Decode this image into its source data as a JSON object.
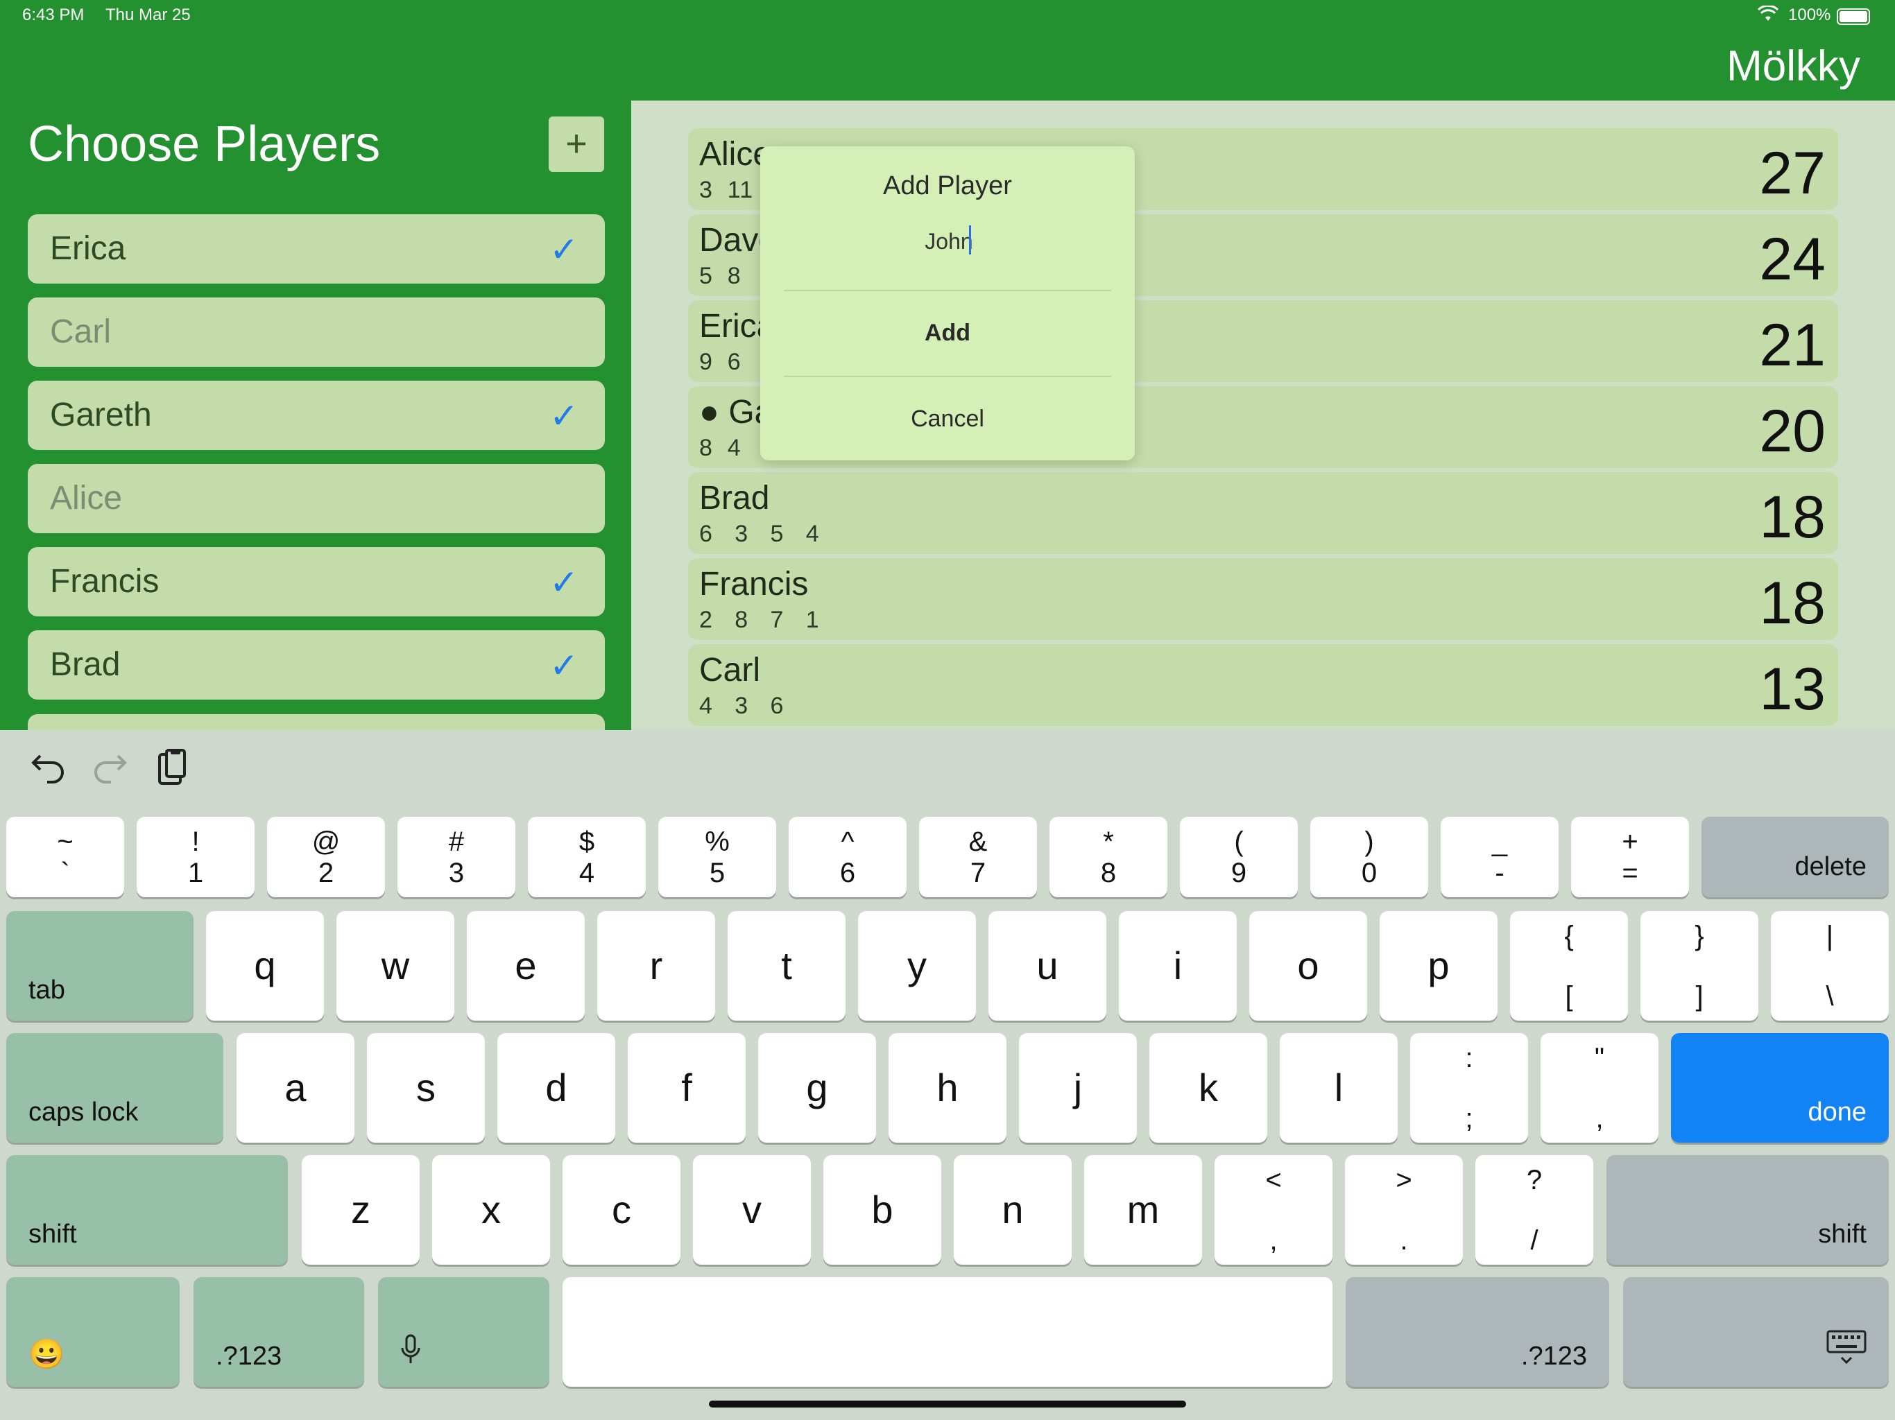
{
  "status_bar": {
    "time": "6:43 PM",
    "date": "Thu Mar 25",
    "battery": "100%"
  },
  "nav": {
    "app_title": "Mölkky"
  },
  "left_panel": {
    "title": "Choose Players",
    "add_button": "+",
    "players": [
      {
        "name": "Erica",
        "selected": true
      },
      {
        "name": "Carl",
        "selected": false
      },
      {
        "name": "Gareth",
        "selected": true
      },
      {
        "name": "Alice",
        "selected": false
      },
      {
        "name": "Francis",
        "selected": true
      },
      {
        "name": "Brad",
        "selected": true
      }
    ],
    "check_glyph": "✓"
  },
  "scoreboard": {
    "rows": [
      {
        "name": "Alice",
        "throws": "3  11",
        "score": "27"
      },
      {
        "name": "Dave",
        "throws": "5  8",
        "score": "24"
      },
      {
        "name": "Erica",
        "throws": "9  6",
        "score": "21"
      },
      {
        "name": "● Ga",
        "throws": "8  4",
        "score": "20"
      },
      {
        "name": "Brad",
        "throws": "6   3   5   4",
        "score": "18"
      },
      {
        "name": "Francis",
        "throws": "2   8   7   1",
        "score": "18"
      },
      {
        "name": "Carl",
        "throws": "4   3   6",
        "score": "13"
      }
    ]
  },
  "dialog": {
    "title": "Add Player",
    "input_value": "John",
    "add_label": "Add",
    "cancel_label": "Cancel"
  },
  "keyboard": {
    "toolbar": {
      "undo_icon": "undo-icon",
      "redo_icon": "redo-icon",
      "paste_icon": "clipboard-icon"
    },
    "row1": [
      {
        "top": "~",
        "bot": "`"
      },
      {
        "top": "!",
        "bot": "1"
      },
      {
        "top": "@",
        "bot": "2"
      },
      {
        "top": "#",
        "bot": "3"
      },
      {
        "top": "$",
        "bot": "4"
      },
      {
        "top": "%",
        "bot": "5"
      },
      {
        "top": "^",
        "bot": "6"
      },
      {
        "top": "&",
        "bot": "7"
      },
      {
        "top": "*",
        "bot": "8"
      },
      {
        "top": "(",
        "bot": "9"
      },
      {
        "top": ")",
        "bot": "0"
      },
      {
        "top": "_",
        "bot": "-"
      },
      {
        "top": "+",
        "bot": "="
      }
    ],
    "delete": "delete",
    "tab": "tab",
    "row2": [
      "q",
      "w",
      "e",
      "r",
      "t",
      "y",
      "u",
      "i",
      "o",
      "p"
    ],
    "row2_sym": [
      {
        "top": "{",
        "bot": "["
      },
      {
        "top": "}",
        "bot": "]"
      },
      {
        "top": "|",
        "bot": "\\"
      }
    ],
    "caps_lock": "caps lock",
    "row3": [
      "a",
      "s",
      "d",
      "f",
      "g",
      "h",
      "j",
      "k",
      "l"
    ],
    "row3_sym": [
      {
        "top": ":",
        "bot": ";"
      },
      {
        "top": "\"",
        "bot": ","
      }
    ],
    "done": "done",
    "shift": "shift",
    "row4": [
      "z",
      "x",
      "c",
      "v",
      "b",
      "n",
      "m"
    ],
    "row4_sym": [
      {
        "top": "<",
        "bot": ","
      },
      {
        "top": ">",
        "bot": "."
      },
      {
        "top": "?",
        "bot": "/"
      }
    ],
    "numbers_label": ".?123",
    "emoji_glyph": "😀",
    "mic_glyph": "🎙",
    "hide_keyboard_glyph": "⌨"
  }
}
